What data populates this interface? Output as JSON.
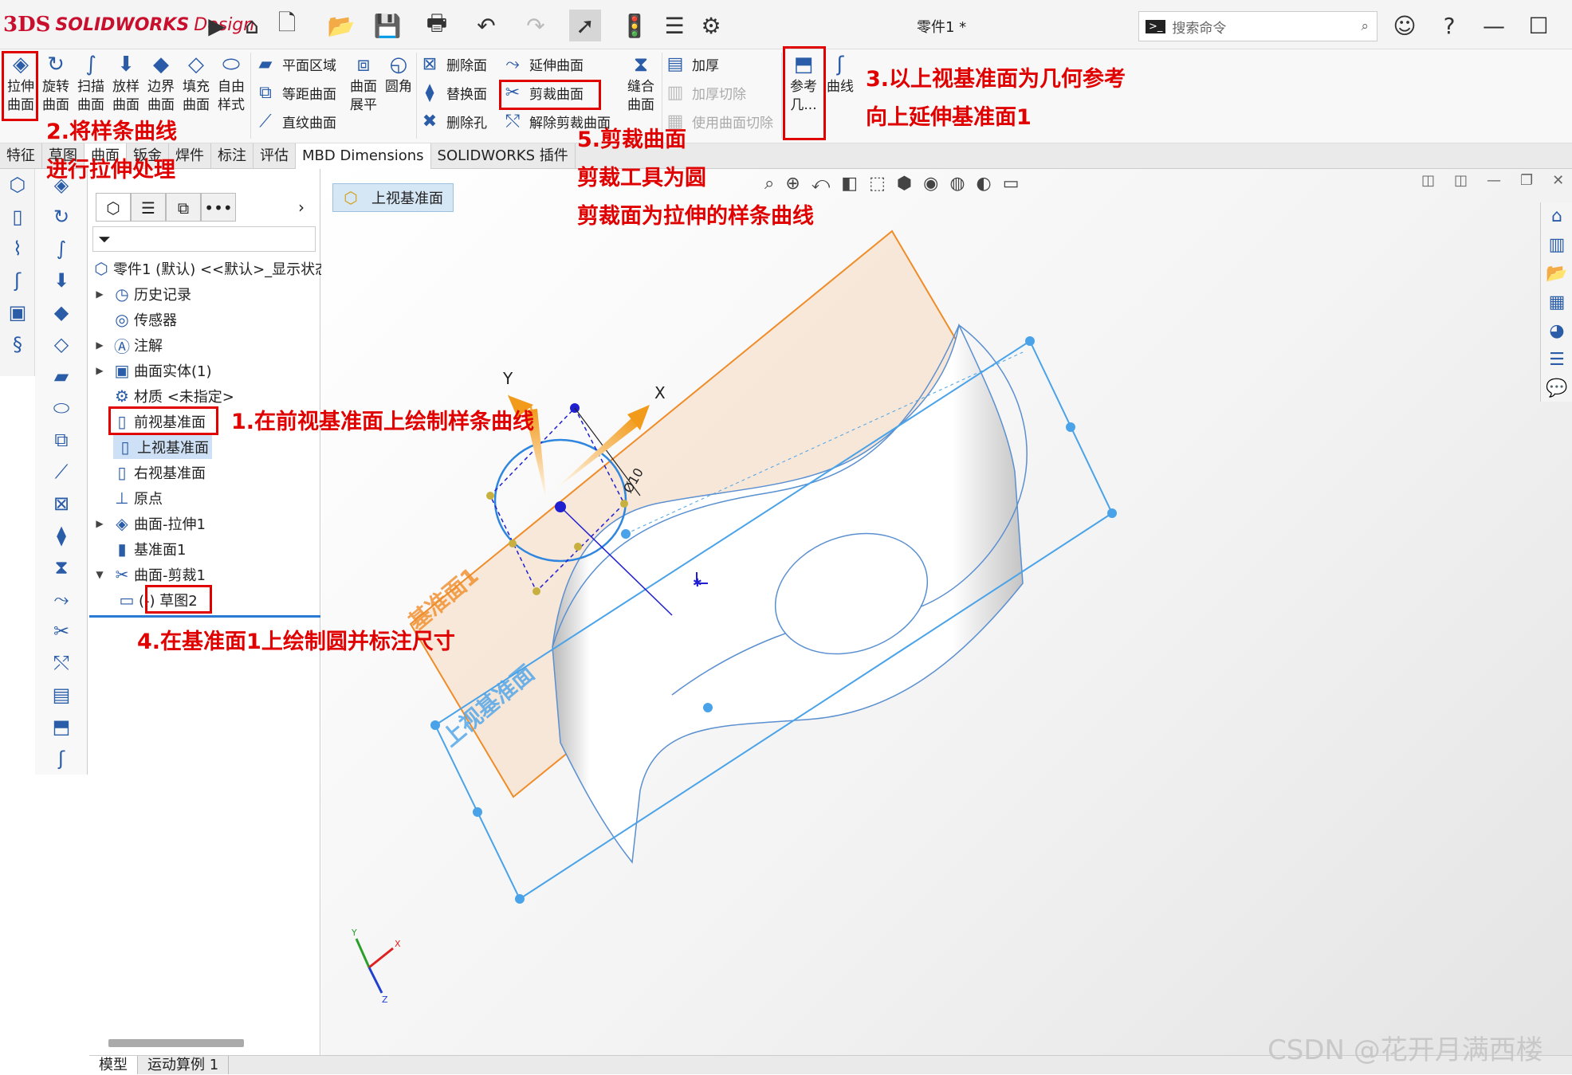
{
  "app": {
    "brand_logo": "3DS",
    "brand_name": "SOLIDWORKS",
    "brand_suffix": "Design",
    "doc_title": "零件1 *",
    "search_placeholder": "搜索命令"
  },
  "ribbon": {
    "extrude_surface": [
      "拉伸",
      "曲面"
    ],
    "revolve_surface": [
      "旋转",
      "曲面"
    ],
    "sweep_surface": [
      "扫描",
      "曲面"
    ],
    "loft_surface": [
      "放样",
      "曲面"
    ],
    "boundary_surface": [
      "边界",
      "曲面"
    ],
    "fill_surface": [
      "填充",
      "曲面"
    ],
    "freeform": [
      "自由",
      "样式"
    ],
    "planar_surface": "平面区域",
    "offset_surface": "等距曲面",
    "ruled_surface": "直纹曲面",
    "surface_flatten": [
      "曲面",
      "展平"
    ],
    "fillet": "圆角",
    "delete_face": "删除面",
    "replace_face": "替换面",
    "delete_hole": "删除孔",
    "extend_surface": "延伸曲面",
    "trim_surface": "剪裁曲面",
    "untrim_surface": "解除剪裁曲面",
    "knit_surface": [
      "缝合",
      "曲面"
    ],
    "thicken": "加厚",
    "thicken_cut": "加厚切除",
    "surface_cut": "使用曲面切除",
    "ref_geometry": [
      "参考",
      "几..."
    ],
    "curves": "曲线"
  },
  "tabs": [
    "特征",
    "草图",
    "曲面",
    "钣金",
    "焊件",
    "标注",
    "评估",
    "MBD Dimensions",
    "SOLIDWORKS 插件"
  ],
  "active_tab": "曲面",
  "tree": {
    "root": "零件1 (默认) <<默认>_显示状态",
    "items": [
      "历史记录",
      "传感器",
      "注解",
      "曲面实体(1)",
      "材质 <未指定>",
      "前视基准面",
      "上视基准面",
      "右视基准面",
      "原点",
      "曲面-拉伸1",
      "基准面1",
      "曲面-剪裁1",
      "(-) 草图2"
    ]
  },
  "viewport": {
    "breadcrumb": "上视基准面",
    "axis_x": "X",
    "axis_y": "Y",
    "plane1_label": "基准面1",
    "top_plane_label": "上视基准面",
    "dim_label": "Ø10",
    "triad": [
      "Y",
      "X",
      "Z"
    ]
  },
  "annotations": {
    "step1": "1.在前视基准面上绘制样条曲线",
    "step2a": "2.将样条曲线",
    "step2b": "进行拉伸处理",
    "step3a": "3.以上视基准面为几何参考",
    "step3b": "向上延伸基准面1",
    "step4": "4.在基准面1上绘制圆并标注尺寸",
    "step5a": "5.剪裁曲面",
    "step5b": "剪裁工具为圆",
    "step5c": "剪裁面为拉伸的样条曲线"
  },
  "bottom_tabs": [
    "模型",
    "运动算例 1"
  ],
  "watermark": "CSDN @花开月满西楼",
  "colors": {
    "accent_red": "#e00000",
    "plane_orange": "#f08c28",
    "sketch_blue": "#2e86de",
    "brand_red": "#c8102e"
  }
}
